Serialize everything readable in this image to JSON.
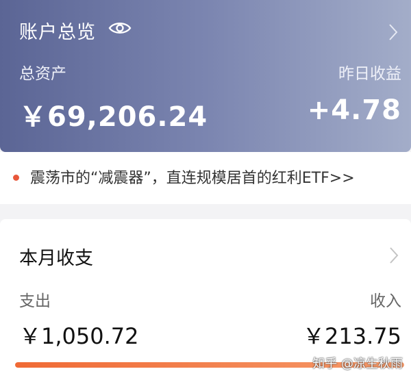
{
  "account": {
    "title": "账户总览",
    "total_assets_label": "总资产",
    "total_assets_value": "￥69,206.24",
    "yesterday_income_label": "昨日收益",
    "yesterday_income_value": "+4.78",
    "visibility_icon": "eye-icon",
    "nav_icon": "chevron-right-icon"
  },
  "promo": {
    "text": "震荡市的“减震器”，直连规模居首的红利ETF>>",
    "dot_color": "#e8573a"
  },
  "monthly": {
    "title": "本月收支",
    "expense_label": "支出",
    "expense_value": "￥1,050.72",
    "income_label": "收入",
    "income_value": "￥213.75",
    "progress_fraction": 1.0
  },
  "watermark": "知乎 @凉生秋雨",
  "colors": {
    "accent": "#f06a35",
    "card_gradient_start": "#5b6595",
    "card_gradient_end": "#a3adc9"
  }
}
